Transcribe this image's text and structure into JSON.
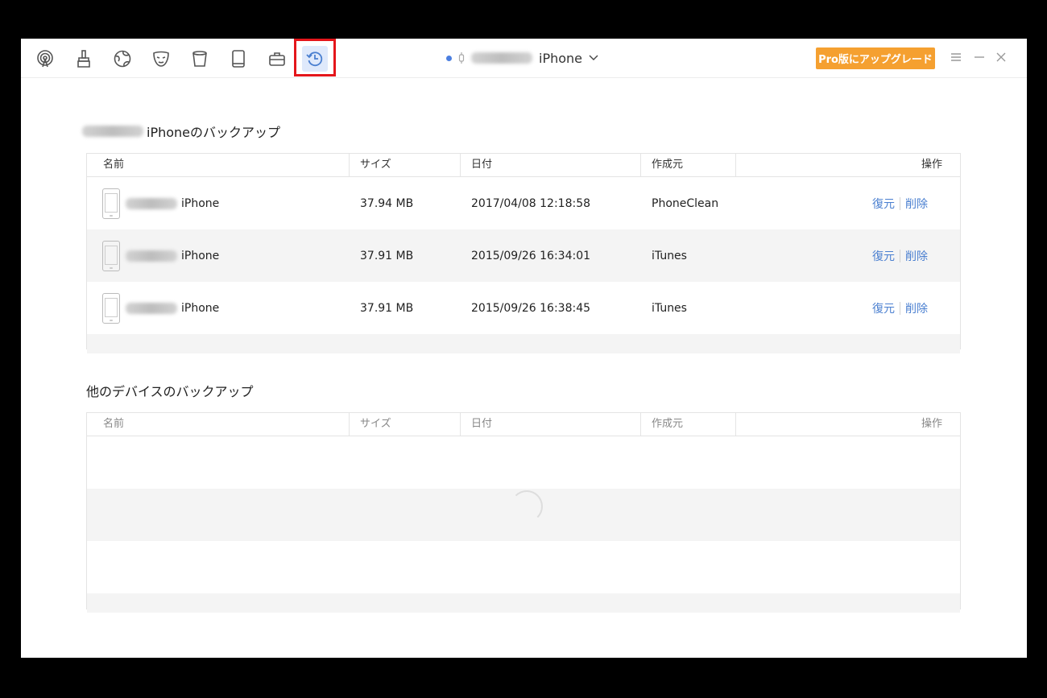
{
  "window": {
    "toolbar": {
      "tools": [
        {
          "name": "airdrop-icon"
        },
        {
          "name": "cleanup-brush-icon"
        },
        {
          "name": "globe-icon"
        },
        {
          "name": "mask-icon"
        },
        {
          "name": "bin-icon"
        },
        {
          "name": "tablet-icon"
        },
        {
          "name": "toolbox-icon"
        },
        {
          "name": "backup-history-icon",
          "active": true
        }
      ],
      "device_label": "iPhone",
      "upgrade_label": "Pro版にアップグレード"
    },
    "backup_section": {
      "title_suffix": "iPhoneのバックアップ",
      "headers": {
        "name": "名前",
        "size": "サイズ",
        "date": "日付",
        "creator": "作成元",
        "actions": "操作"
      },
      "rows": [
        {
          "device": "iPhone",
          "size": "37.94 MB",
          "date": "2017/04/08 12:18:58",
          "creator": "PhoneClean",
          "restore": "復元",
          "delete": "削除"
        },
        {
          "device": "iPhone",
          "size": "37.91 MB",
          "date": "2015/09/26 16:34:01",
          "creator": "iTunes",
          "restore": "復元",
          "delete": "削除"
        },
        {
          "device": "iPhone",
          "size": "37.91 MB",
          "date": "2015/09/26 16:38:45",
          "creator": "iTunes",
          "restore": "復元",
          "delete": "削除"
        }
      ]
    },
    "other_section": {
      "title": "他のデバイスのバックアップ",
      "headers": {
        "name": "名前",
        "size": "サイズ",
        "date": "日付",
        "creator": "作成元",
        "actions": "操作"
      }
    }
  },
  "colors": {
    "accent": "#4a7fd0",
    "upgrade": "#f5a030",
    "highlight": "#e4161b"
  }
}
